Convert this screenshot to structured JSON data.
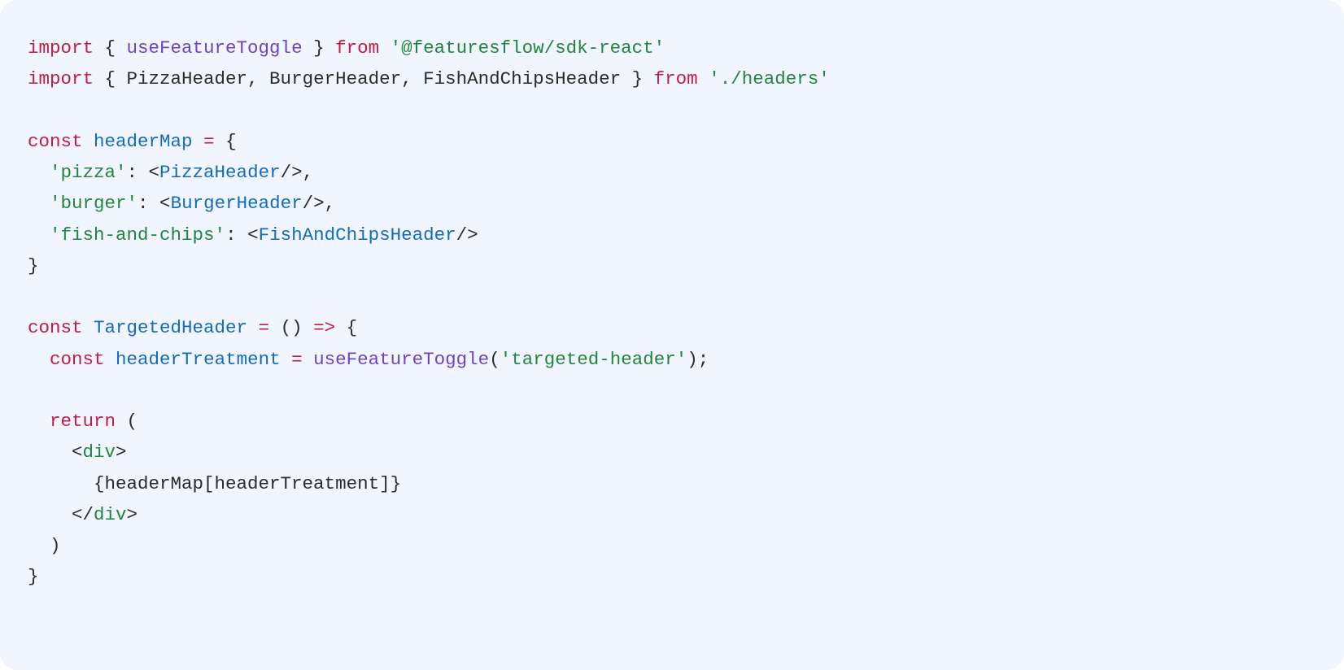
{
  "code": {
    "l1": {
      "kw_import": "import",
      "brace_open": " { ",
      "fn": "useFeatureToggle",
      "brace_close": " } ",
      "kw_from": "from",
      "sp": " ",
      "str": "'@featuresflow/sdk-react'"
    },
    "l2": {
      "kw_import": "import",
      "brace_open": " { ",
      "ids": "PizzaHeader, BurgerHeader, FishAndChipsHeader",
      "brace_close": " } ",
      "kw_from": "from",
      "sp": " ",
      "str": "'./headers'"
    },
    "l3": "",
    "l4": {
      "kw_const": "const",
      "sp1": " ",
      "id": "headerMap",
      "sp2": " ",
      "op_eq": "=",
      "rest": " {"
    },
    "l5": {
      "indent": "  ",
      "str": "'pizza'",
      "colon": ": <",
      "comp": "PizzaHeader",
      "close": "/>,"
    },
    "l6": {
      "indent": "  ",
      "str": "'burger'",
      "colon": ": <",
      "comp": "BurgerHeader",
      "close": "/>,"
    },
    "l7": {
      "indent": "  ",
      "str": "'fish-and-chips'",
      "colon": ": <",
      "comp": "FishAndChipsHeader",
      "close": "/>"
    },
    "l8": "}",
    "l9": "",
    "l10": {
      "kw_const": "const",
      "sp1": " ",
      "id": "TargetedHeader",
      "sp2": " ",
      "op_eq": "=",
      "sp3": " () ",
      "op_arrow": "=>",
      "rest": " {"
    },
    "l11": {
      "indent": "  ",
      "kw_const": "const",
      "sp1": " ",
      "id": "headerTreatment",
      "sp2": " ",
      "op_eq": "=",
      "sp3": " ",
      "fn": "useFeatureToggle",
      "paren_open": "(",
      "str": "'targeted-header'",
      "paren_close": ");"
    },
    "l12": "",
    "l13": {
      "indent": "  ",
      "kw_return": "return",
      "rest": " ("
    },
    "l14": {
      "indent": "    ",
      "lt": "<",
      "tag": "div",
      "gt": ">"
    },
    "l15": {
      "indent": "      ",
      "expr": "{headerMap[headerTreatment]}"
    },
    "l16": {
      "indent": "    ",
      "lt": "</",
      "tag": "div",
      "gt": ">"
    },
    "l17": "  )",
    "l18": "}"
  }
}
